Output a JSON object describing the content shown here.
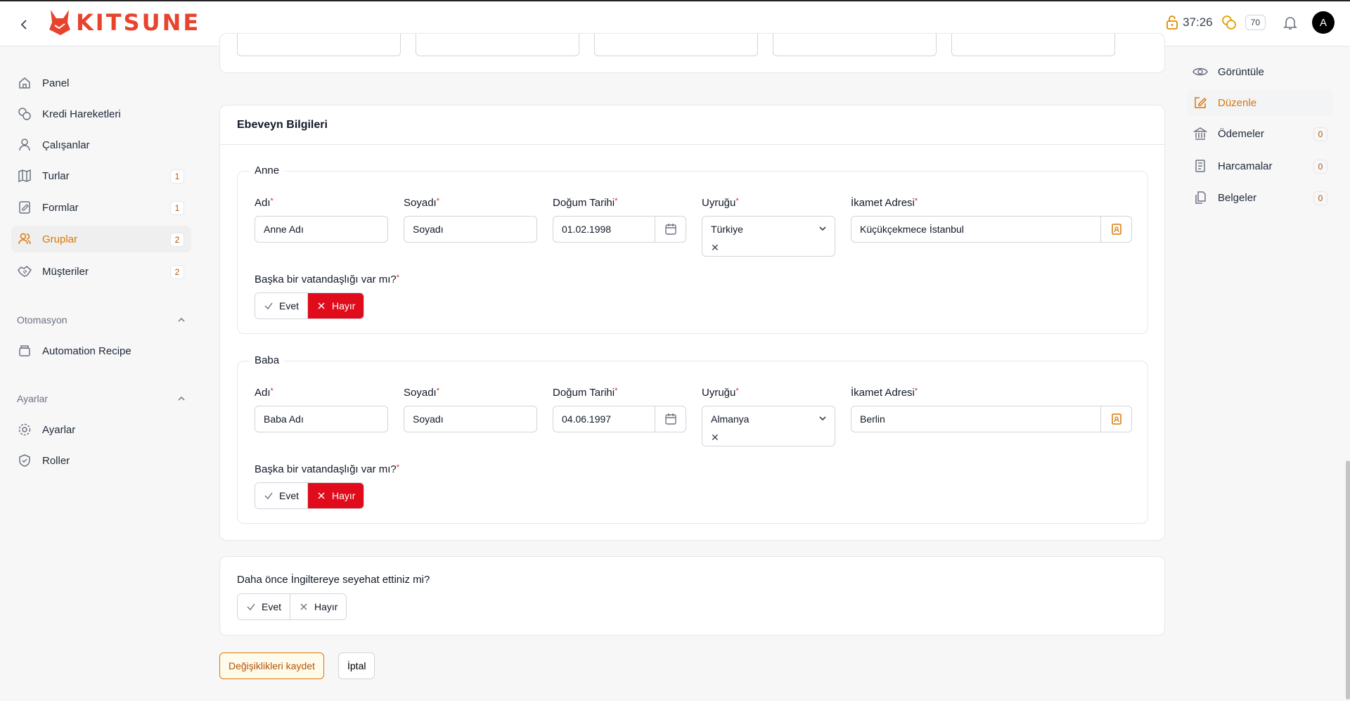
{
  "brand": {
    "name": "KITSUNE",
    "accent": "#e8432d"
  },
  "topbar": {
    "timer": "37:26",
    "credits": "70",
    "avatar_initial": "A"
  },
  "sidebar": {
    "items": [
      {
        "label": "Panel",
        "icon": "home-icon",
        "count": ""
      },
      {
        "label": "Kredi Hareketleri",
        "icon": "coins-icon",
        "count": ""
      },
      {
        "label": "Çalışanlar",
        "icon": "user-icon",
        "count": ""
      },
      {
        "label": "Turlar",
        "icon": "map-icon",
        "count": "1"
      },
      {
        "label": "Formlar",
        "icon": "form-icon",
        "count": "1"
      },
      {
        "label": "Gruplar",
        "icon": "users-icon",
        "count": "2"
      },
      {
        "label": "Müşteriler",
        "icon": "handshake-icon",
        "count": "2"
      }
    ],
    "automation_section": "Otomasyon",
    "automation_item": "Automation Recipe",
    "settings_section": "Ayarlar",
    "settings_items": [
      "Ayarlar",
      "Roller"
    ]
  },
  "parent_card": {
    "title": "Ebeveyn Bilgileri",
    "mother": {
      "legend": "Anne",
      "first_name_label": "Adı",
      "first_name": "Anne Adı",
      "last_name_label": "Soyadı",
      "last_name": "Soyadı",
      "birth_label": "Doğum Tarihi",
      "birth": "01.02.1998",
      "nationality_label": "Uyruğu",
      "nationality": "Türkiye",
      "address_label": "İkamet Adresi",
      "address": "Küçükçekmece İstanbul",
      "dual_question": "Başka bir vatandaşlığı var mı?",
      "yes": "Evet",
      "no": "Hayır"
    },
    "father": {
      "legend": "Baba",
      "first_name_label": "Adı",
      "first_name": "Baba Adı",
      "last_name_label": "Soyadı",
      "last_name": "Soyadı",
      "birth_label": "Doğum Tarihi",
      "birth": "04.06.1997",
      "nationality_label": "Uyruğu",
      "nationality": "Almanya",
      "address_label": "İkamet Adresi",
      "address": "Berlin",
      "dual_question": "Başka bir vatandaşlığı var mı?",
      "yes": "Evet",
      "no": "Hayır"
    }
  },
  "uk_card": {
    "question": "Daha önce İngiltereye seyehat ettiniz mi?",
    "yes": "Evet",
    "no": "Hayır"
  },
  "actions": {
    "save": "Değişiklikleri kaydet",
    "cancel": "İptal"
  },
  "right_nav": {
    "items": [
      {
        "label": "Görüntüle",
        "icon": "eye-icon",
        "count": ""
      },
      {
        "label": "Düzenle",
        "icon": "edit-icon",
        "count": ""
      },
      {
        "label": "Ödemeler",
        "icon": "bank-icon",
        "count": "0"
      },
      {
        "label": "Harcamalar",
        "icon": "receipt-icon",
        "count": "0"
      },
      {
        "label": "Belgeler",
        "icon": "documents-icon",
        "count": "0"
      }
    ]
  },
  "colors": {
    "active": "#d97706",
    "danger": "#e00b1b"
  }
}
